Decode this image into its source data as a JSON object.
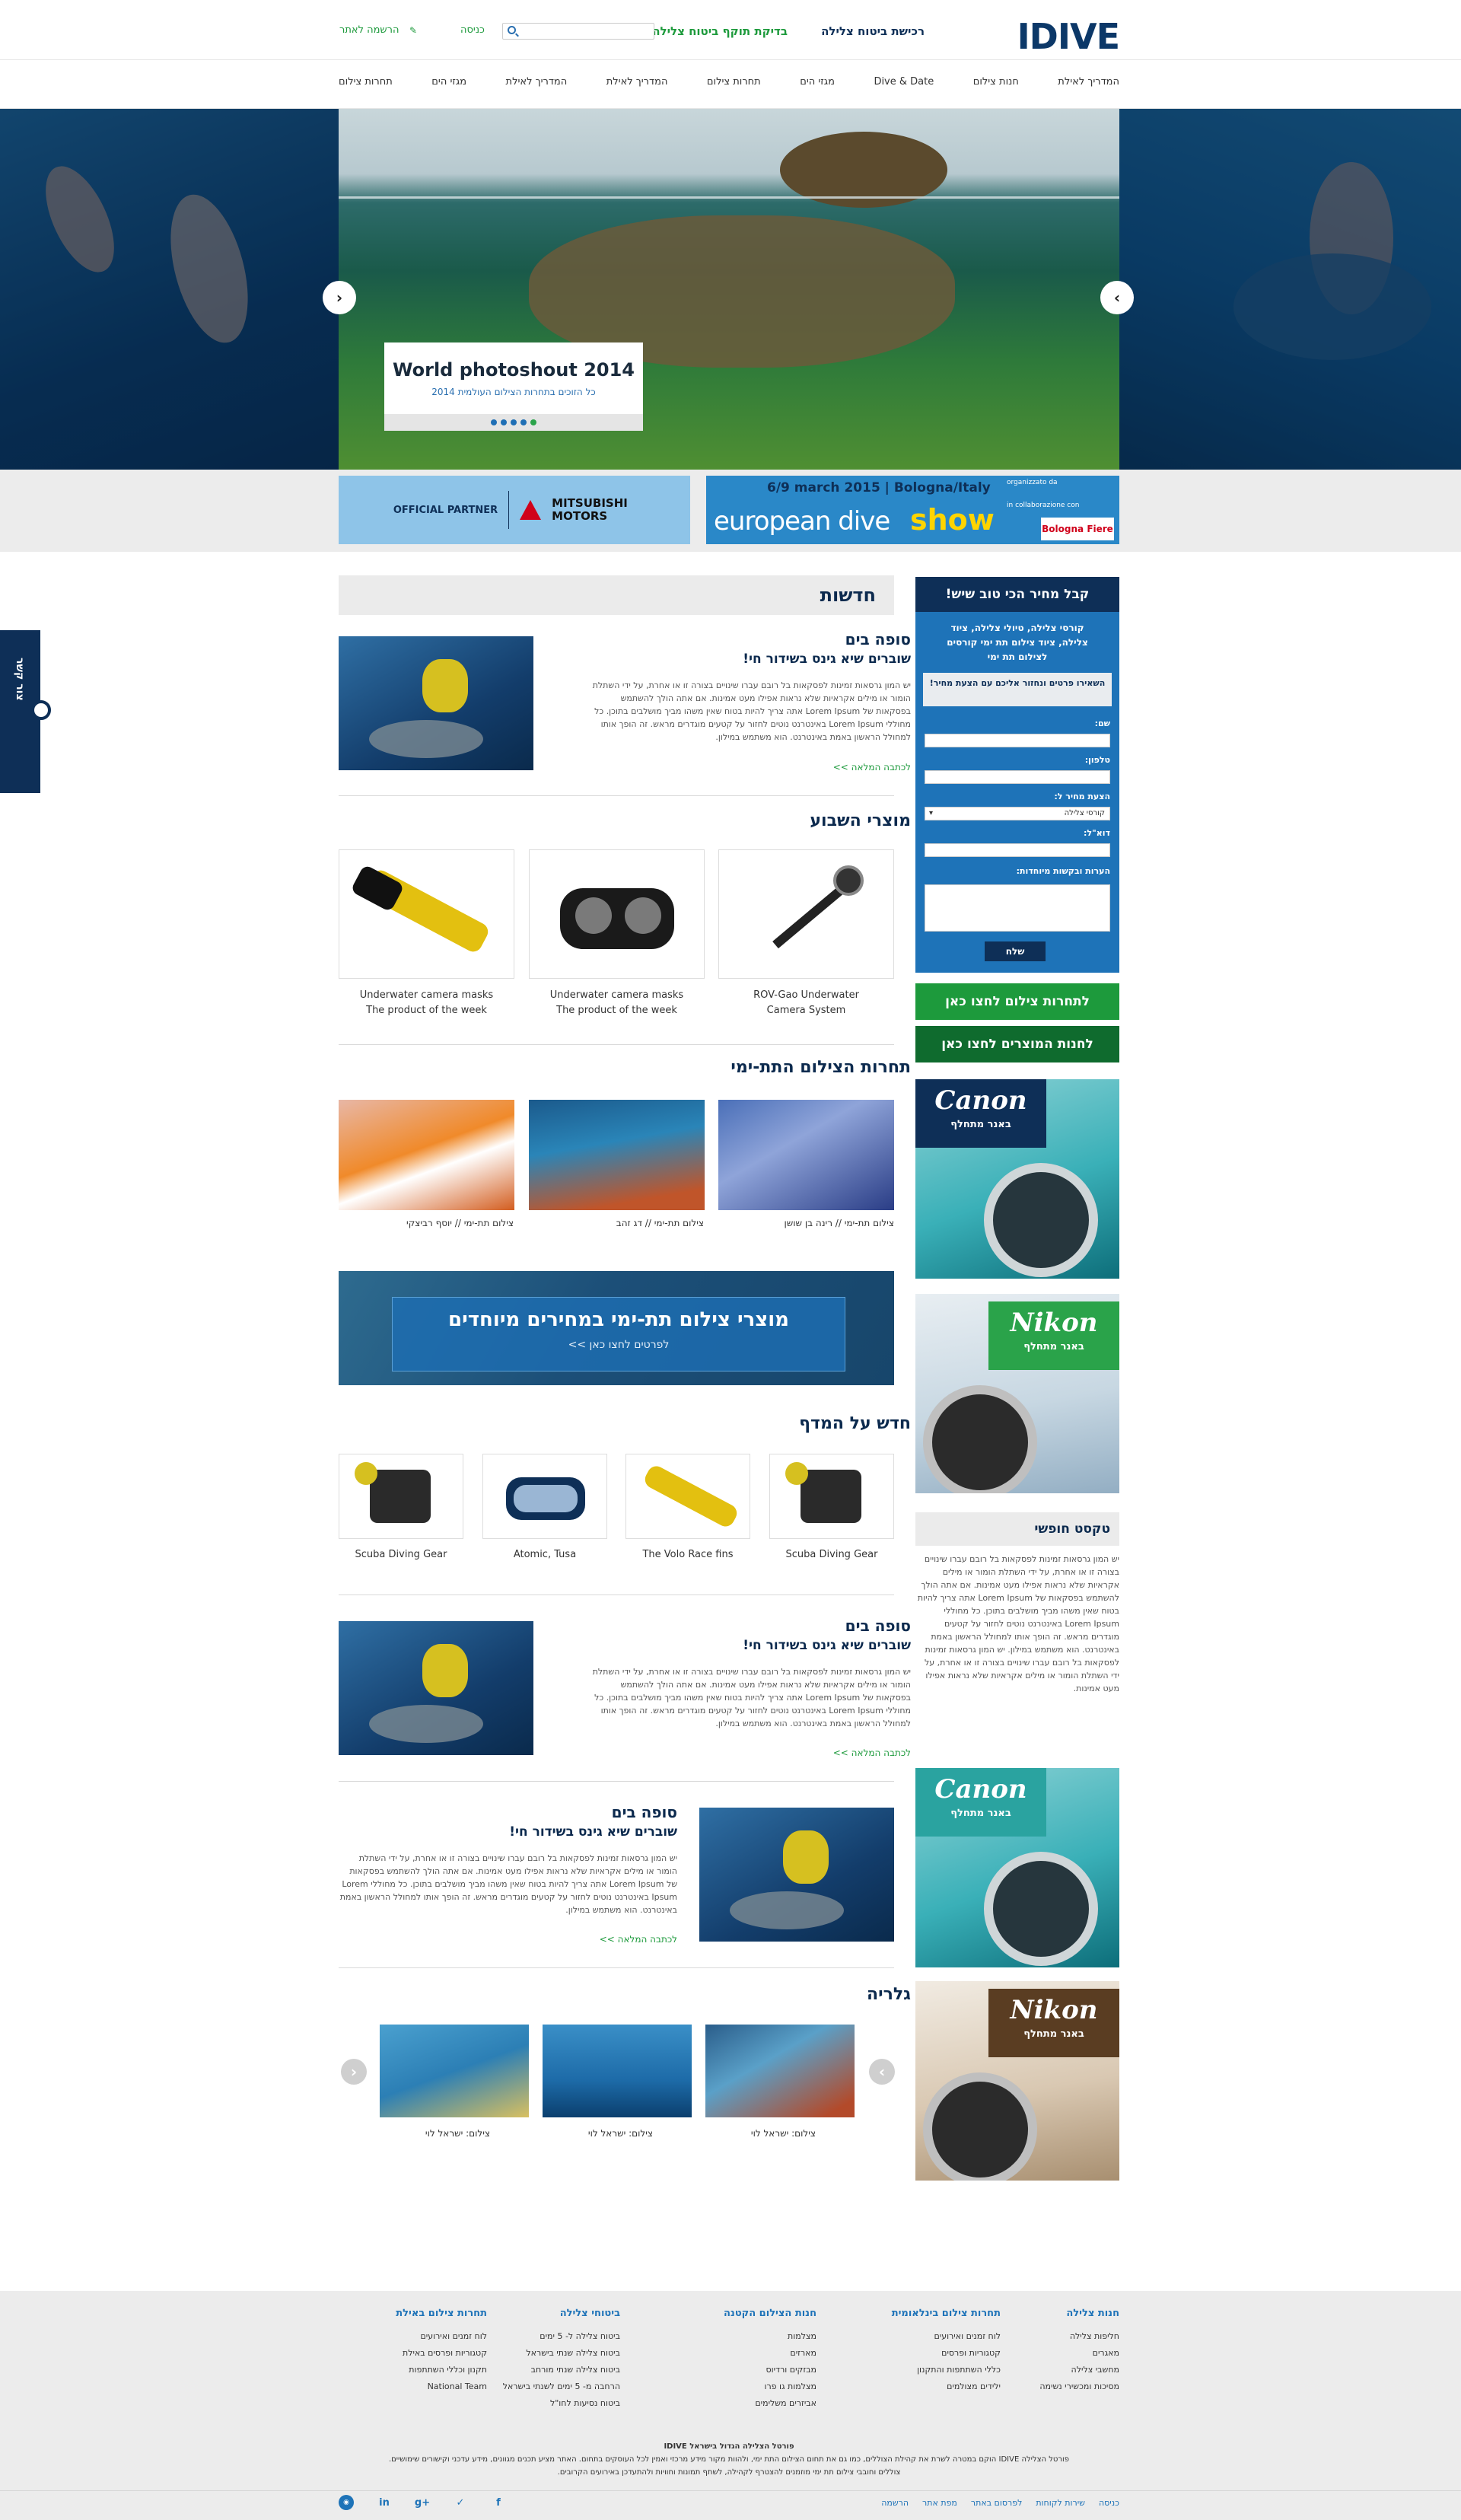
{
  "header": {
    "logo": "IDIVE",
    "links": [
      "רכישת ביטוח צלילה",
      "בדיקת תוקף ביטוח צלילה"
    ],
    "login": "כניסה",
    "register": "הרשמה לאתר",
    "search_placeholder": ""
  },
  "nav": [
    "המדריך לאילת",
    "חנות צילום",
    "Dive & Date",
    "מגזי הים",
    "תחרות צילום",
    "המדריך לאילת",
    "המדריך לאילת",
    "מגזי הים",
    "תחרות צילום"
  ],
  "slider": {
    "title": "World photoshout 2014",
    "subtitle": "כל הזוכים בתחרות הצילום העולמית 2014",
    "dots": 5,
    "active_dot": 5
  },
  "banners": {
    "left": {
      "partner": "OFFICIAL PARTNER",
      "brand": "MITSUBISHI MOTORS"
    },
    "right": {
      "date": "6/9 march 2015 | Bologna/Italy",
      "title_a": "european dive",
      "title_b": "show",
      "org": "organizzato da",
      "collab": "in collaborazione con",
      "fair": "Bologna Fiere"
    }
  },
  "news": {
    "title": "חדשות",
    "article": {
      "title": "סופה בים",
      "subtitle": "שוברים שיא גינס בשידור חי!",
      "body": "יש המון גרסאות זמינות לפסקאות בל רובם עברו שינויים בצורה זו או אחרת, על ידי השתלת הומור או מילים אקראיות שלא נראות אפילו מעט אמינות. אם אתה הולך להשתמש בפסקאות של Lorem Ipsum אתה צריך להיות בטוח שאין משהו מביך מושלבים בתוכן. כל מחוללי Lorem Ipsum באינטרנט נוטים לחזור על קטעים מוגדרים מראש. זה הופך אותו למחולל הראשון באמת באינטרנט. הוא משתמש במילון.",
      "more": "לכתבה המלאה >>"
    }
  },
  "products_week": {
    "title": "מוצרי השבוע",
    "items": [
      {
        "line1": "ROV-Gao Underwater",
        "line2": "Camera System"
      },
      {
        "line1": "Underwater camera masks",
        "line2": "The product of the week"
      },
      {
        "line1": "Underwater camera masks",
        "line2": "The product of the week"
      }
    ]
  },
  "competition": {
    "title": "תחרות הצילום התת-ימי",
    "items": [
      "צילום תת-ימי // רינה בן שושן",
      "צילום תת-ימי // דג זהב",
      "צילום תת-ימי // יוסף רביצקי"
    ]
  },
  "promo": {
    "title": "מוצרי צילום תת-ימי במחירים מיוחדים",
    "subtitle": "לפרטים לחצו כאן >>"
  },
  "shelf": {
    "title": "חדש על המדף",
    "items": [
      "Scuba Diving Gear",
      "The Volo Race fins",
      "Atomic, Tusa",
      "Scuba Diving Gear"
    ]
  },
  "article2": {
    "title": "סופה בים",
    "subtitle": "שוברים שיא גינס בשידור חי!",
    "body": "יש המון גרסאות זמינות לפסקאות בל רובם עברו שינויים בצורה זו או אחרת, על ידי השתלת הומור או מילים אקראיות שלא נראות אפילו מעט אמינות. אם אתה הולך להשתמש בפסקאות של Lorem Ipsum אתה צריך להיות בטוח שאין משהו מביך מושלבים בתוכן. כל מחוללי Lorem Ipsum באינטרנט נוטים לחזור על קטעים מוגדרים מראש. זה הופך אותו למחולל הראשון באמת באינטרנט. הוא משתמש במילון.",
    "more": "לכתבה המלאה >>"
  },
  "article3": {
    "title": "סופה בים",
    "subtitle": "שוברים שיא גינס בשידור חי!",
    "body": "יש המון גרסאות זמינות לפסקאות בל רובם עברו שינויים בצורה זו או אחרת, על ידי השתלת הומור או מילים אקראיות שלא נראות אפילו מעט אמינות. אם אתה הולך להשתמש בפסקאות של Lorem Ipsum אתה צריך להיות בטוח שאין משהו מביך מושלבים בתוכן. כל מחוללי Lorem Ipsum באינטרנט נוטים לחזור על קטעים מוגדרים מראש. זה הופך אותו למחולל הראשון באמת באינטרנט. הוא משתמש במילון.",
    "more": "לכתבה המלאה >>"
  },
  "gallery": {
    "title": "גלריה",
    "items": [
      "צילום: ישראל לוי",
      "צילום: ישראל לוי",
      "צילום: ישראל לוי"
    ]
  },
  "form": {
    "header": "קבל מחיר הכי טוב שיש!",
    "intro": "קורסי צלילה, טיולי צלילה, ציוד צלילה, ציוד צילום תת ימי קורסים לצילום תת ימי",
    "note": "השאירו פרטים ונחזור אליכם עם הצעת מחיר!",
    "labels": {
      "name": "שם:",
      "phone": "טלפון:",
      "quote": "הצעת מחיר ל:",
      "email": "דוא\"ל:",
      "comments": "הערות ובקשות מיוחדות:"
    },
    "select_value": "קורסי צלילה",
    "send": "שלח"
  },
  "side_buttons": [
    "לתחרות צילום לחצו כאן",
    "לחנות המוצרים לחצו כאן"
  ],
  "ads": [
    {
      "brand": "Canon",
      "note": "באנר מתחלף"
    },
    {
      "brand": "Nikon",
      "note": "באנר מתחלף"
    },
    {
      "brand": "Canon",
      "note": "באנר מתחלף"
    },
    {
      "brand": "Nikon",
      "note": "באנר מתחלף"
    }
  ],
  "free_text": {
    "title": "טקסט חופשי",
    "body": "יש המון גרסאות זמינות לפסקאות בל רובם עברו שינויים בצורה זו או אחרת, על ידי השתלת הומור או מילים אקראיות שלא נראות אפילו מעט אמינות. אם אתה הולך להשתמש בפסקאות של Lorem Ipsum אתה צריך להיות בטוח שאין משהו מביך מושלבים בתוכן. כל מחוללי Lorem Ipsum באינטרנט נוטים לחזור על קטעים מוגדרים מראש. זה הופך אותו למחולל הראשון באמת באינטרנט. הוא משתמש במילון. יש המון גרסאות זמינות לפסקאות בל רובם עברו שינויים בצורה זו או אחרת, על ידי השתלת הומור או מילים אקראיות שלא נראות אפילו מעט אמינות."
  },
  "sidetab": "צור קשר",
  "footer": {
    "cols": [
      {
        "title": "חנות צלילה",
        "items": [
          "חליפות צלילה",
          "מאגרים",
          "מחשבי צלילה",
          "מסיכות ומכשירי נשימה"
        ]
      },
      {
        "title": "תחרות צילום בינלאומית",
        "items": [
          "לוח זמנים ואירועים",
          "קטגוריות ופרסים",
          "כללי השתתפות והתקנון",
          "ילידים מצולמים"
        ]
      },
      {
        "title": "חנות הצילום הקטנה",
        "items": [
          "מצלמות",
          "מארזים",
          "מבזקים ורדיוס",
          "מצלמות גו פרו",
          "אביזרים משלימים"
        ]
      },
      {
        "title": "ביטוחי צלילה",
        "items": [
          "ביטוח צלילה ל- 5 ימים",
          "ביטוח צלילה שנתי בישראל",
          "ביטוח צלילה שנתי מורחב",
          "הרחבה מ- 5 ימים לשנתי בישראל",
          "ביטוח נסיעות לחו\"ל"
        ]
      },
      {
        "title": "תחרות צילום באילת",
        "items": [
          "לוח זמנים ואירועים",
          "קטגוריות ופרסים באילת",
          "תקנון וכללי השתתפות",
          "National Team"
        ]
      }
    ],
    "legal_1": "פורטל הצלילה הגדול בישראל IDIVE",
    "legal_2": "פורטל הצלילה IDIVE הוקם במטרה לשרת את קהילת הצוללים, כמו גם את תחום הצילום התת ימי, ולהוות מקור מידע מרכזי ואמין לכל העוסקים בתחום. האתר מציע תכנים מגוונים, מידע עדכני וקישורים שימושיים.",
    "legal_3": "צוללים וחובבי צילום תת ימי מוזמנים להצטרף לקהילה, לשתף תמונות וחוויות ולהתעדכן באירועים הקרובים.",
    "links": [
      "כניסה",
      "שירות לקוחות",
      "לפרסום באתר",
      "מפת אתר",
      "הרשמה"
    ],
    "social": [
      "f",
      "t",
      "g+",
      "in",
      "rss"
    ]
  }
}
